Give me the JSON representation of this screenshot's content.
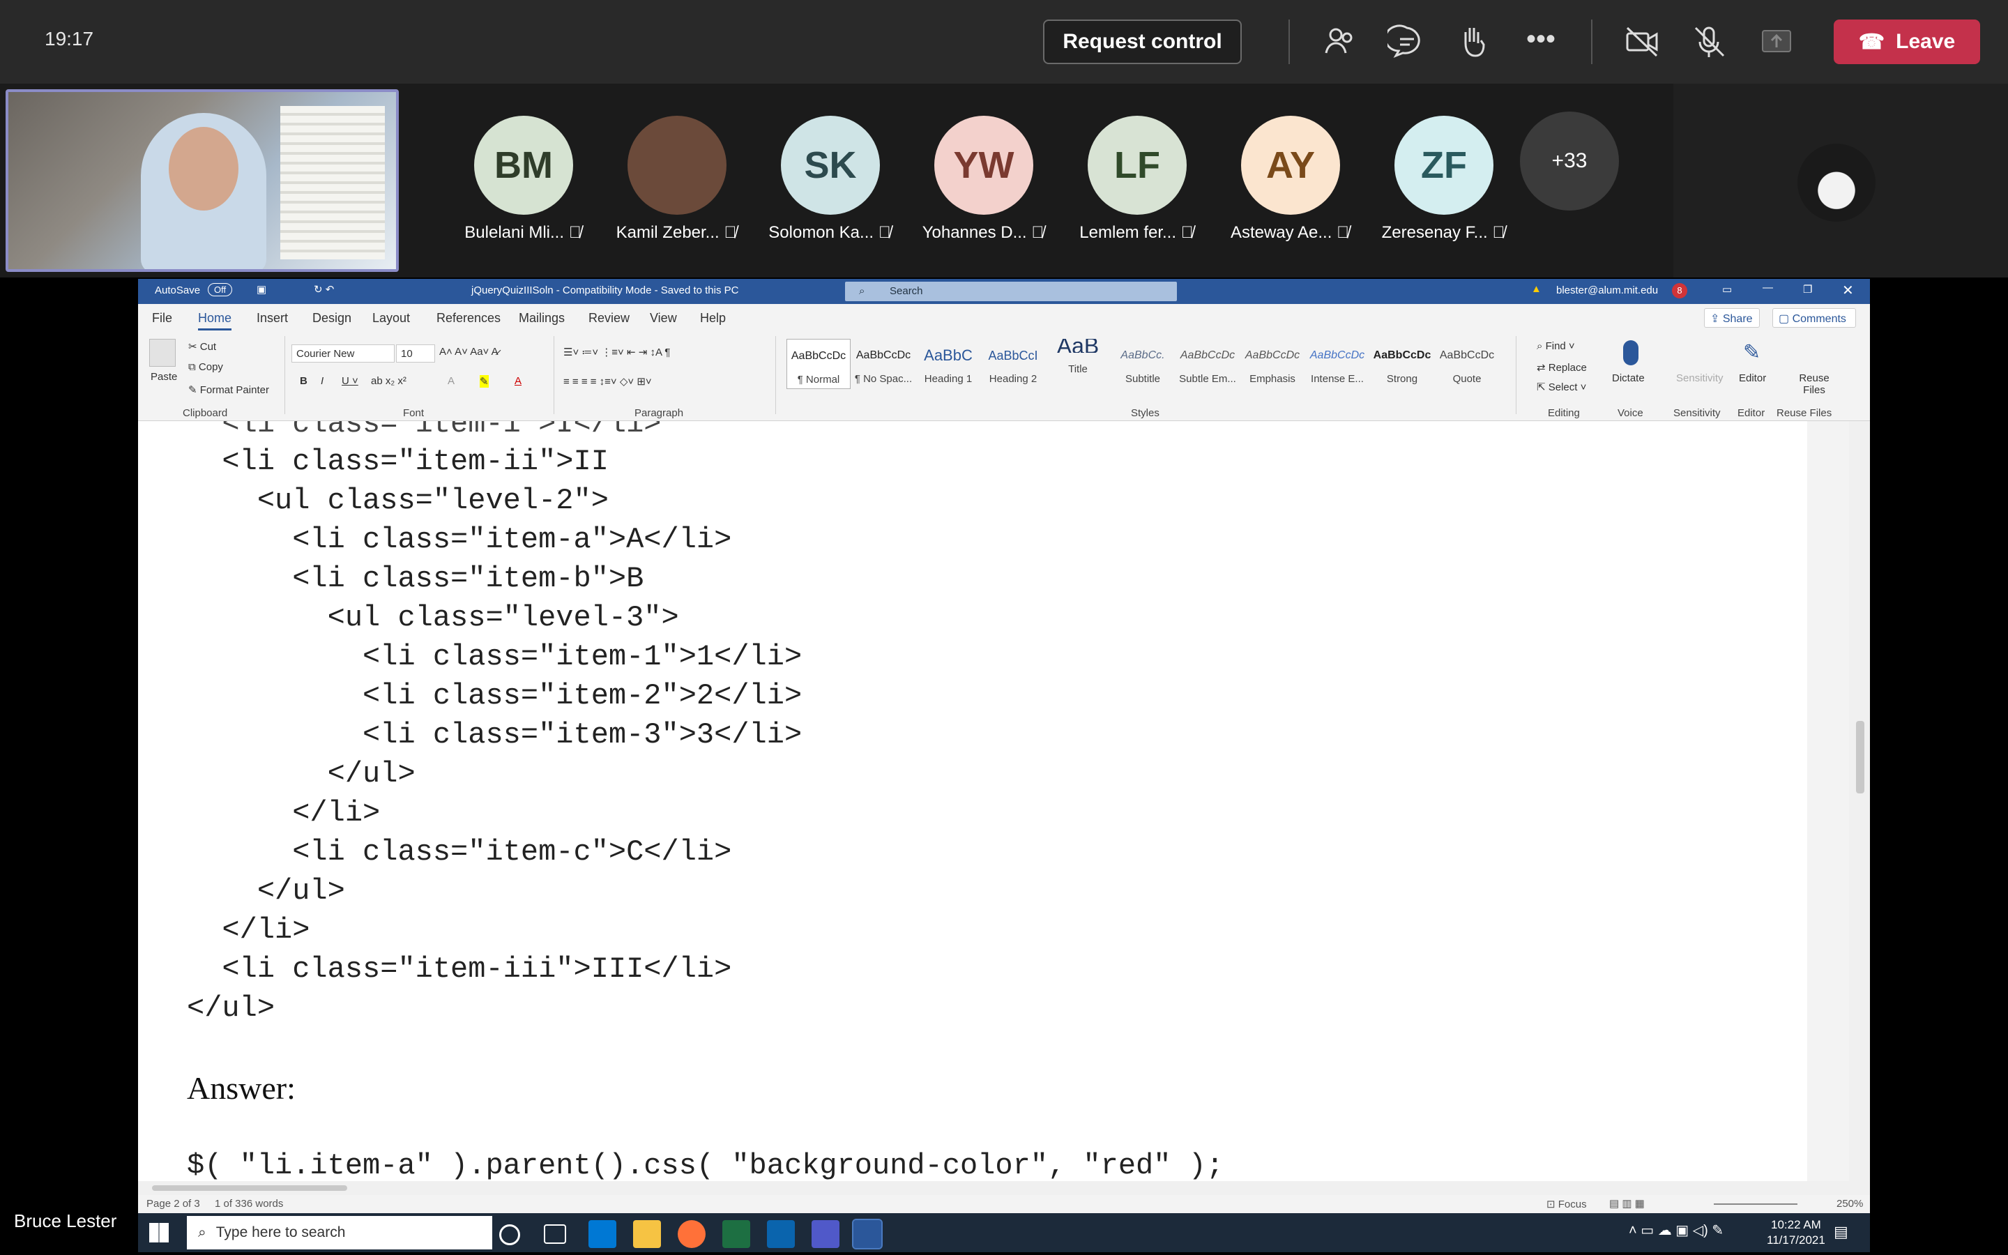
{
  "teams": {
    "clock": "19:17",
    "request_control": "Request control",
    "leave": "Leave",
    "participants": [
      {
        "initials": "BM",
        "name": "Bulelani Mli...",
        "color": "#d6e3d2",
        "text": "#2f3d2a"
      },
      {
        "initials": "",
        "name": "Kamil Zeber...",
        "color": "#6b4a3a",
        "text": "#fff"
      },
      {
        "initials": "SK",
        "name": "Solomon Ka...",
        "color": "#cfe4e6",
        "text": "#2d4a4e"
      },
      {
        "initials": "YW",
        "name": "Yohannes D...",
        "color": "#f3d1cc",
        "text": "#7a3a30"
      },
      {
        "initials": "LF",
        "name": "Lemlem fer...",
        "color": "#d8e3d4",
        "text": "#304a2a"
      },
      {
        "initials": "AY",
        "name": "Asteway Ae...",
        "color": "#fbe5cf",
        "text": "#7a4a1a"
      },
      {
        "initials": "ZF",
        "name": "Zeresenay F...",
        "color": "#d4eef0",
        "text": "#2a5a5e"
      }
    ],
    "more_count": "+33",
    "presenter_name": "Bruce Lester"
  },
  "word": {
    "autosave": "AutoSave",
    "autosave_state": "Off",
    "doc_title": "jQueryQuizIIISoln - Compatibility Mode - Saved to this PC",
    "search": "Search",
    "account": "blester@alum.mit.edu",
    "tabs": [
      "File",
      "Home",
      "Insert",
      "Design",
      "Layout",
      "References",
      "Mailings",
      "Review",
      "View",
      "Help"
    ],
    "share": "Share",
    "comments": "Comments",
    "clipboard": {
      "paste": "Paste",
      "cut": "Cut",
      "copy": "Copy",
      "format_painter": "Format Painter",
      "label": "Clipboard"
    },
    "font": {
      "name": "Courier New",
      "size": "10",
      "label": "Font"
    },
    "paragraph_label": "Paragraph",
    "styles": [
      {
        "preview": "AaBbCcDc",
        "label": "¶ Normal"
      },
      {
        "preview": "AaBbCcDc",
        "label": "¶ No Spac..."
      },
      {
        "preview": "AaBbC",
        "label": "Heading 1"
      },
      {
        "preview": "AaBbCcI",
        "label": "Heading 2"
      },
      {
        "preview": "AaB",
        "label": "Title"
      },
      {
        "preview": "AaBbCc.",
        "label": "Subtitle"
      },
      {
        "preview": "AaBbCcDc",
        "label": "Subtle Em..."
      },
      {
        "preview": "AaBbCcDc",
        "label": "Emphasis"
      },
      {
        "preview": "AaBbCcDc",
        "label": "Intense E..."
      },
      {
        "preview": "AaBbCcDc",
        "label": "Strong"
      },
      {
        "preview": "AaBbCcDc",
        "label": "Quote"
      }
    ],
    "styles_label": "Styles",
    "editing": {
      "find": "Find",
      "replace": "Replace",
      "select": "Select",
      "label": "Editing"
    },
    "voice": {
      "dictate": "Dictate",
      "label": "Voice"
    },
    "sensitivity": {
      "button": "Sensitivity",
      "label": "Sensitivity"
    },
    "editor": {
      "button": "Editor",
      "label": "Editor"
    },
    "reuse": {
      "button": "Reuse Files",
      "label": "Reuse Files"
    },
    "code_lines": [
      "  <li class=\"item-ii\">II",
      "    <ul class=\"level-2\">",
      "      <li class=\"item-a\">A</li>",
      "      <li class=\"item-b\">B",
      "        <ul class=\"level-3\">",
      "          <li class=\"item-1\">1</li>",
      "          <li class=\"item-2\">2</li>",
      "          <li class=\"item-3\">3</li>",
      "        </ul>",
      "      </li>",
      "      <li class=\"item-c\">C</li>",
      "    </ul>",
      "  </li>",
      "  <li class=\"item-iii\">III</li>",
      "</ul>"
    ],
    "answer_heading": "Answer:",
    "answer_code": "$( \"li.item-a\" ).parent().css( \"background-color\", \"red\" );",
    "status": {
      "page": "Page 2 of 3",
      "words": "1 of 336 words",
      "focus": "Focus",
      "zoom": "250%"
    }
  },
  "taskbar": {
    "search_placeholder": "Type here to search",
    "time": "10:22 AM",
    "date": "11/17/2021"
  }
}
